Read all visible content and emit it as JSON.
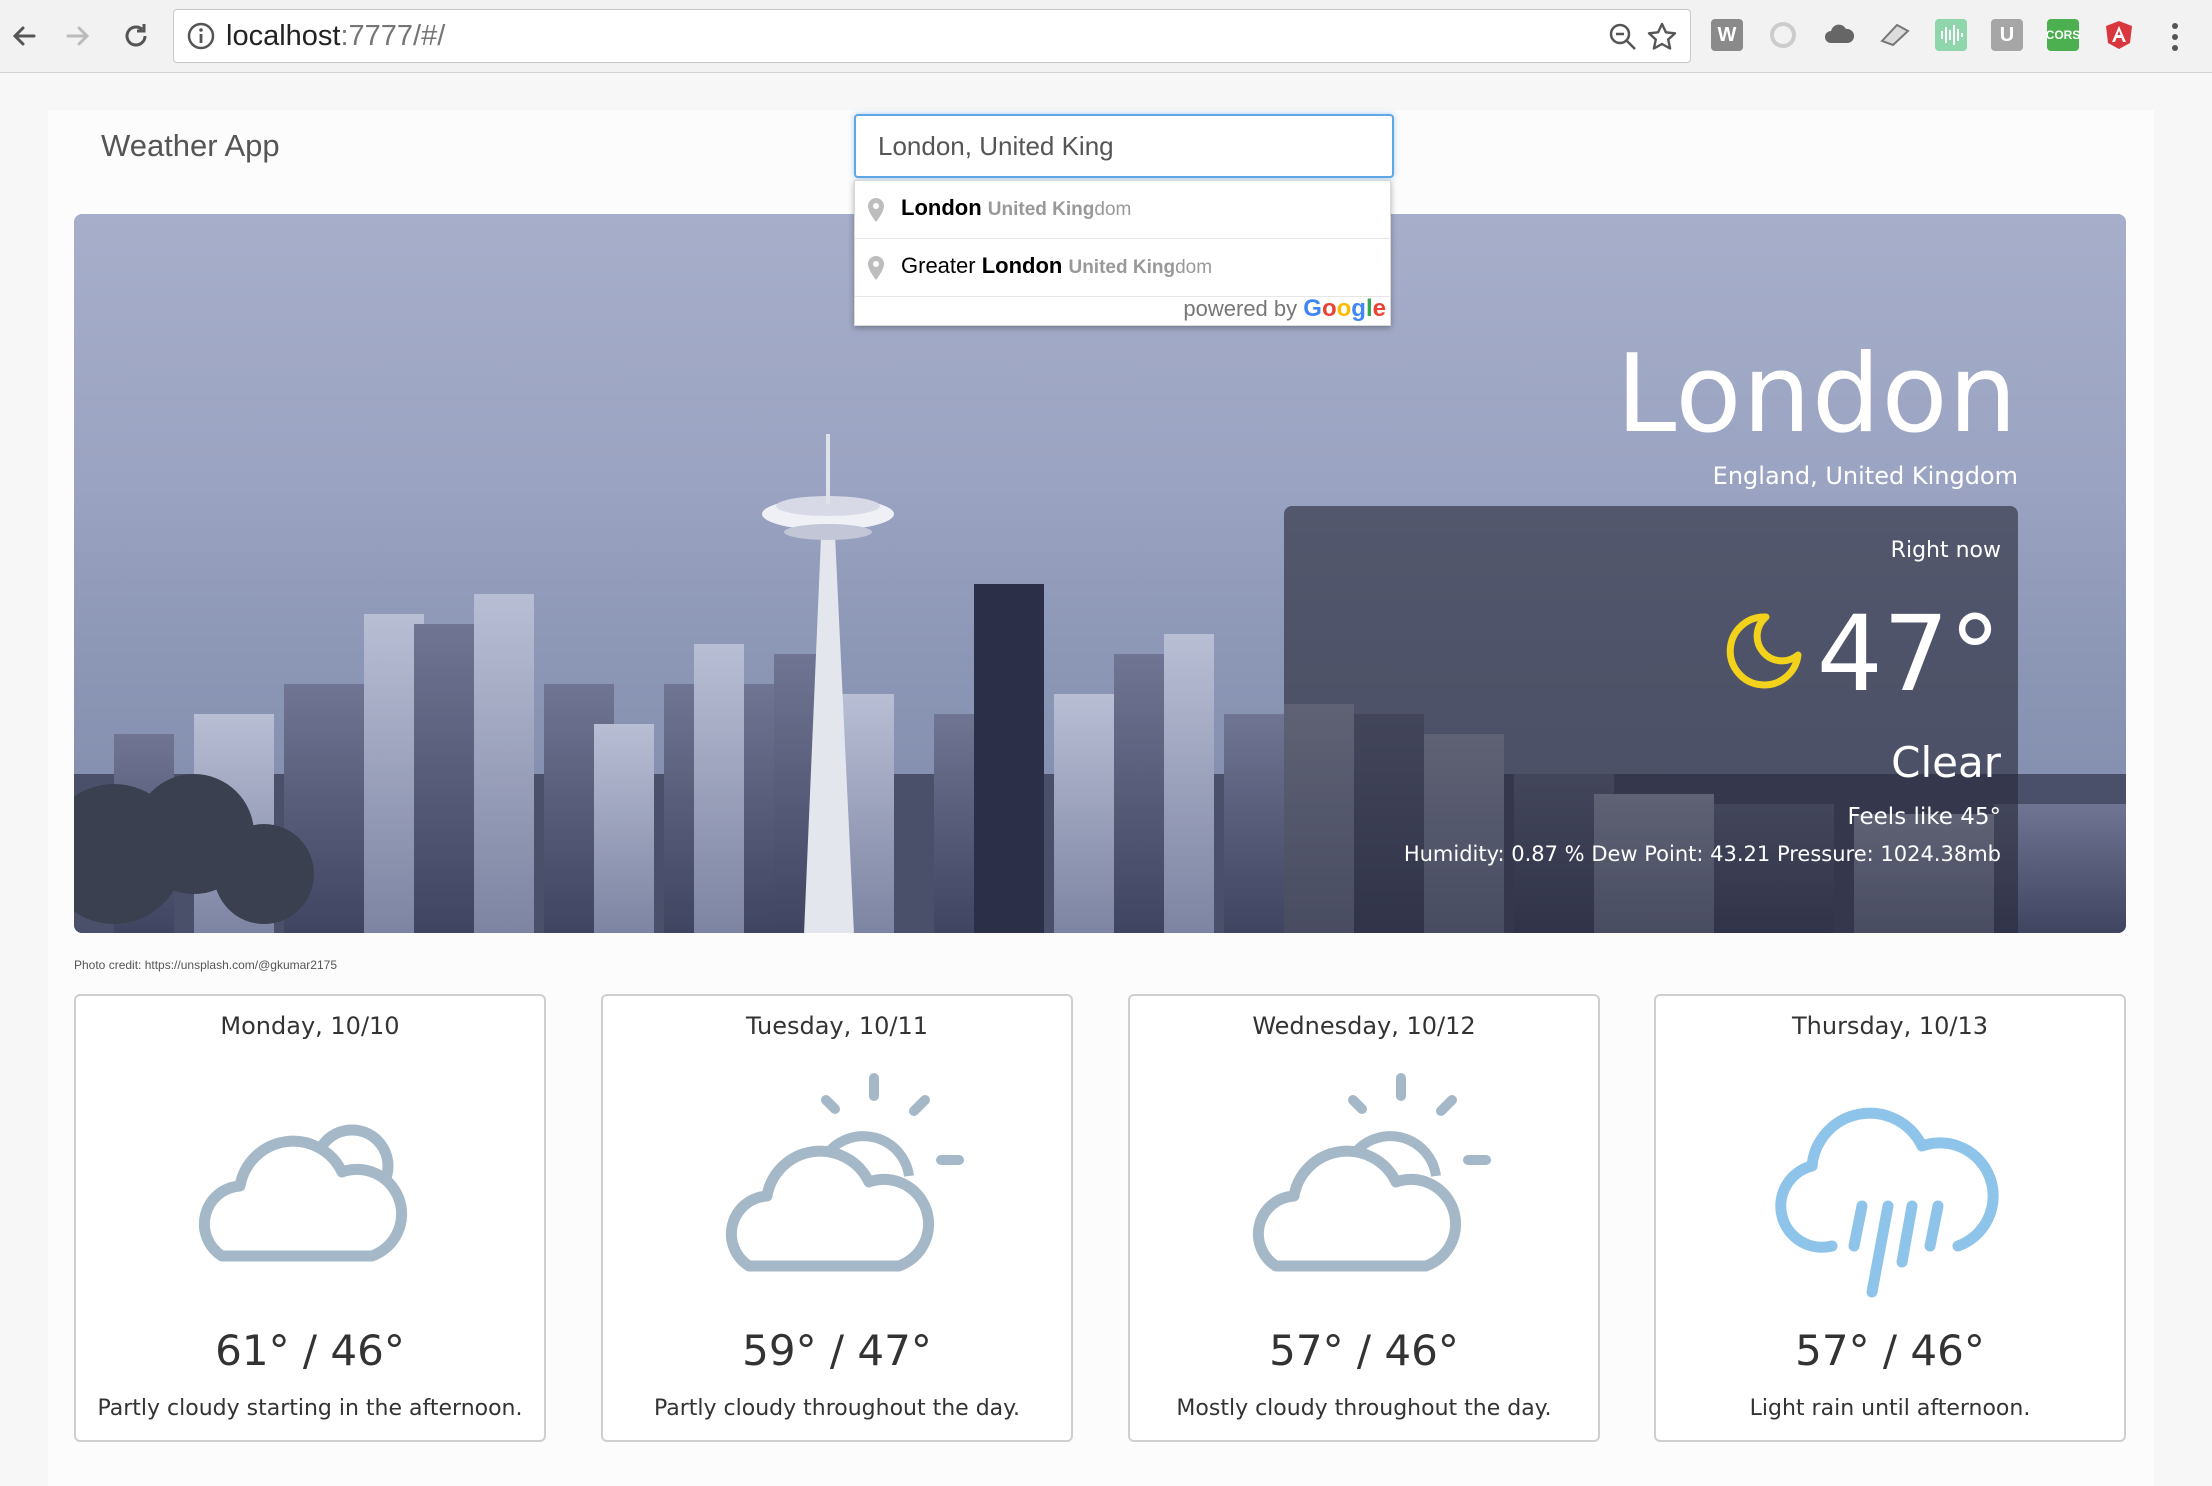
{
  "browser": {
    "url_host": "localhost",
    "url_rest": ":7777/#/"
  },
  "app": {
    "brand": "Weather App",
    "search_value": "London, United King"
  },
  "autocomplete": {
    "items": [
      {
        "prefix": "",
        "match": "London",
        "secondary_match": "United King",
        "secondary_rest": "dom"
      },
      {
        "prefix": "Greater ",
        "match": "London",
        "secondary_match": "United King",
        "secondary_rest": "dom"
      }
    ],
    "powered_by": "powered by",
    "google": [
      "G",
      "o",
      "o",
      "g",
      "l",
      "e"
    ],
    "google_colors": [
      "#4285f4",
      "#ea4335",
      "#fbbc05",
      "#4285f4",
      "#34a853",
      "#ea4335"
    ]
  },
  "current": {
    "city": "London",
    "region": "England, United Kingdom",
    "label": "Right now",
    "temperature": "47°",
    "condition": "Clear",
    "feels_like": "Feels like 45°",
    "details": "Humidity: 0.87 % Dew Point: 43.21 Pressure: 1024.38mb",
    "icon": "clear-night-moon-icon"
  },
  "photo_credit": "Photo credit: https://unsplash.com/@gkumar2175",
  "forecast": [
    {
      "day": "Monday, 10/10",
      "temps": "61° / 46°",
      "summary": "Partly cloudy starting in the afternoon.",
      "icon": "partly-cloudy-night-icon"
    },
    {
      "day": "Tuesday, 10/11",
      "temps": "59° / 47°",
      "summary": "Partly cloudy throughout the day.",
      "icon": "partly-cloudy-day-icon"
    },
    {
      "day": "Wednesday, 10/12",
      "temps": "57° / 46°",
      "summary": "Mostly cloudy throughout the day.",
      "icon": "partly-cloudy-day-icon"
    },
    {
      "day": "Thursday, 10/13",
      "temps": "57° / 46°",
      "summary": "Light rain until afternoon.",
      "icon": "rain-icon"
    }
  ],
  "colors": {
    "accent_yellow": "#f2d21b",
    "icon_grey": "#a5b8c8",
    "icon_blue": "#8ec4ea",
    "search_focus": "#5fa8e8"
  }
}
